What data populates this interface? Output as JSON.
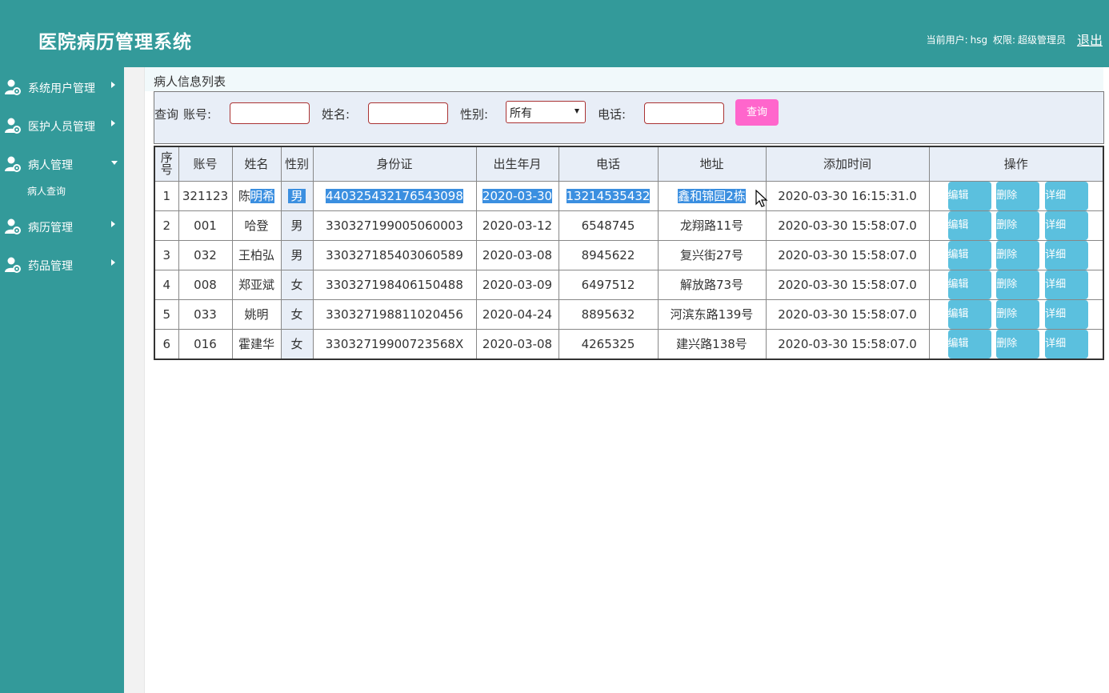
{
  "header": {
    "title": "医院病历管理系统",
    "user_label": "当前用户:",
    "user_name": "hsg",
    "role_label": "权限:",
    "role_name": "超级管理员",
    "logout": "退出"
  },
  "sidebar": {
    "items": [
      {
        "label": "系统用户管理",
        "icon": "user-gear-icon",
        "expanded": false
      },
      {
        "label": "医护人员管理",
        "icon": "user-gear-icon",
        "expanded": false
      },
      {
        "label": "病人管理",
        "icon": "user-gear-icon",
        "expanded": true
      },
      {
        "label": "病历管理",
        "icon": "user-gear-icon",
        "expanded": false
      },
      {
        "label": "药品管理",
        "icon": "user-gear-icon",
        "expanded": false
      }
    ],
    "sub_item": "病人查询"
  },
  "main": {
    "page_title": "病人信息列表",
    "query": {
      "prefix": "查询",
      "account_label": "账号:",
      "account_value": "",
      "name_label": "姓名:",
      "name_value": "",
      "gender_label": "性别:",
      "gender_selected": "所有",
      "phone_label": "电话:",
      "phone_value": "",
      "button": "查询"
    },
    "table": {
      "columns": [
        "序号",
        "账号",
        "姓名",
        "性别",
        "身份证",
        "出生年月",
        "电话",
        "地址",
        "添加时间",
        "操作"
      ],
      "actions": [
        "编辑",
        "删除",
        "详细"
      ],
      "rows": [
        {
          "no": "1",
          "account": "321123",
          "name_a": "陈",
          "name_b": "明希",
          "gender": "男",
          "id_card": "440325432176543098",
          "birth": "2020-03-30",
          "phone": "13214535432",
          "address": "鑫和锦园2栋",
          "added": "2020-03-30 16:15:31.0"
        },
        {
          "no": "2",
          "account": "001",
          "name_a": "哈登",
          "name_b": "",
          "gender": "男",
          "id_card": "330327199005060003",
          "birth": "2020-03-12",
          "phone": "6548745",
          "address": "龙翔路11号",
          "added": "2020-03-30 15:58:07.0"
        },
        {
          "no": "3",
          "account": "032",
          "name_a": "王柏弘",
          "name_b": "",
          "gender": "男",
          "id_card": "330327185403060589",
          "birth": "2020-03-08",
          "phone": "8945622",
          "address": "复兴街27号",
          "added": "2020-03-30 15:58:07.0"
        },
        {
          "no": "4",
          "account": "008",
          "name_a": "郑亚斌",
          "name_b": "",
          "gender": "女",
          "id_card": "330327198406150488",
          "birth": "2020-03-09",
          "phone": "6497512",
          "address": "解放路73号",
          "added": "2020-03-30 15:58:07.0"
        },
        {
          "no": "5",
          "account": "033",
          "name_a": "姚明",
          "name_b": "",
          "gender": "女",
          "id_card": "330327198811020456",
          "birth": "2020-04-24",
          "phone": "8895632",
          "address": "河滨东路139号",
          "added": "2020-03-30 15:58:07.0"
        },
        {
          "no": "6",
          "account": "016",
          "name_a": "霍建华",
          "name_b": "",
          "gender": "女",
          "id_card": "33032719900723568X",
          "birth": "2020-03-08",
          "phone": "4265325",
          "address": "建兴路138号",
          "added": "2020-03-30 15:58:07.0"
        }
      ]
    }
  },
  "colors": {
    "brand": "#339a9a",
    "query_button": "#ff66cc",
    "action_button": "#5bc0de",
    "selection": "#3b8fe0"
  }
}
